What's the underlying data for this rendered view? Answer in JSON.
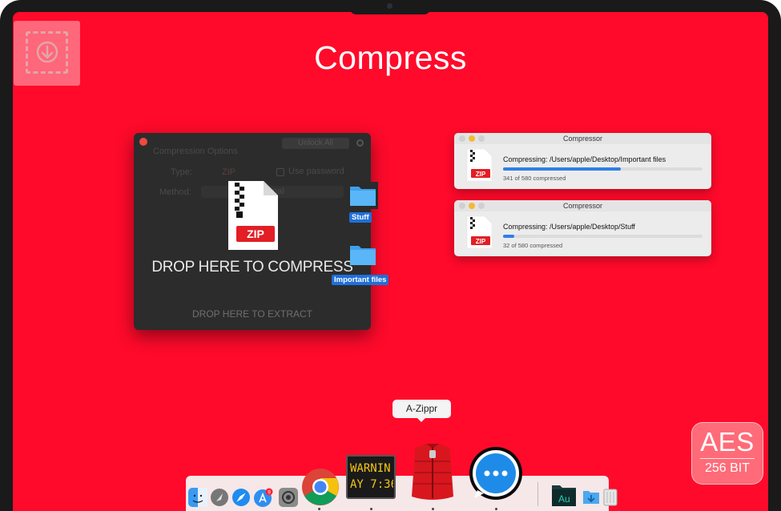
{
  "hero": {
    "title": "Compress"
  },
  "compress_window": {
    "section_title": "Compression Options",
    "unlock_label": "Unlock All",
    "type_label": "Type:",
    "type_value": "ZIP",
    "use_password_label": "Use password",
    "method_label": "Method:",
    "method_value": "mal",
    "zip_badge": "ZIP",
    "drop_compress": "DROP HERE TO COMPRESS",
    "drop_extract": "DROP HERE TO EXTRACT"
  },
  "dragged_items": [
    {
      "label": "Stuff"
    },
    {
      "label": "Important files"
    }
  ],
  "compressor_windows": [
    {
      "title": "Compressor",
      "status": "Compressing: /Users/apple/Desktop/Important files",
      "count": "341 of 580 compressed",
      "progress": 0.59,
      "zip_badge": "ZIP"
    },
    {
      "title": "Compressor",
      "status": "Compressing: /Users/apple/Desktop/Stuff",
      "count": "32 of 580 compressed",
      "progress": 0.055,
      "zip_badge": "ZIP"
    }
  ],
  "dock": {
    "tooltip": "A-Zippr",
    "warning_line1": "WARNIN",
    "warning_line2": "AY 7:36",
    "appstore_badge": "9",
    "au_label": "Au"
  },
  "aes_badge": {
    "line1": "AES",
    "line2": "256 BIT"
  },
  "colors": {
    "background": "#ff0a2b",
    "accent_blue": "#2f7fe8",
    "zip_red": "#e31e24"
  }
}
